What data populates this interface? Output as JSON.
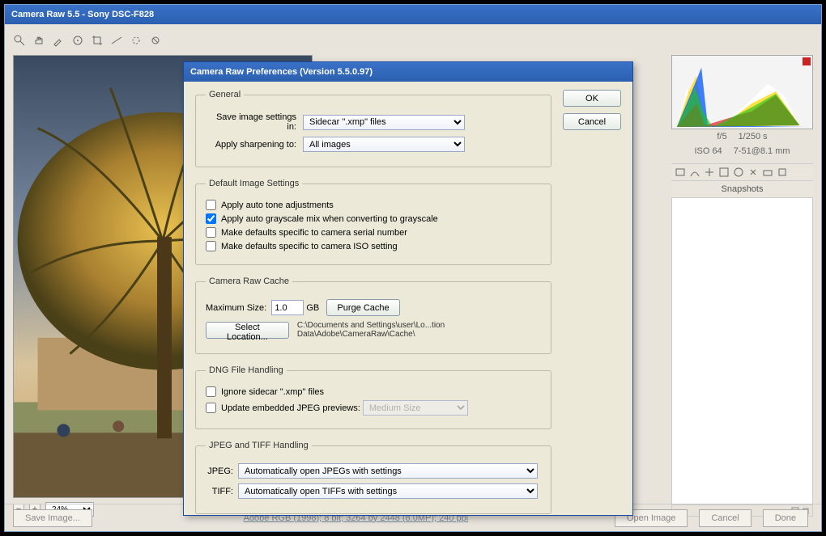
{
  "app": {
    "title": "Camera Raw 5.5  -  Sony DSC-F828"
  },
  "zoom": {
    "value": "24%"
  },
  "footer": {
    "save_image": "Save Image...",
    "meta": "Adobe RGB (1998); 8 bit; 3264 by 2448 (8.0MP); 240 ppi",
    "open_image": "Open Image",
    "cancel": "Cancel",
    "done": "Done"
  },
  "right": {
    "info1a": "f/5",
    "info1b": "1/250 s",
    "info2a": "ISO 64",
    "info2b": "7-51@8.1 mm",
    "panel_title": "Snapshots"
  },
  "dialog": {
    "title": "Camera Raw Preferences  (Version 5.5.0.97)",
    "ok": "OK",
    "cancel": "Cancel",
    "general": {
      "legend": "General",
      "save_in_label": "Save image settings in:",
      "save_in_value": "Sidecar \".xmp\" files",
      "sharpen_label": "Apply sharpening to:",
      "sharpen_value": "All images"
    },
    "defaults": {
      "legend": "Default Image Settings",
      "auto_tone": "Apply auto tone adjustments",
      "auto_gray": "Apply auto grayscale mix when converting to grayscale",
      "serial": "Make defaults specific to camera serial number",
      "iso": "Make defaults specific to camera ISO setting"
    },
    "cache": {
      "legend": "Camera Raw Cache",
      "max_label": "Maximum Size:",
      "max_value": "1.0",
      "gb": "GB",
      "purge": "Purge Cache",
      "select": "Select Location...",
      "path": "C:\\Documents and Settings\\user\\Lo...tion Data\\Adobe\\CameraRaw\\Cache\\"
    },
    "dng": {
      "legend": "DNG File Handling",
      "ignore": "Ignore sidecar \".xmp\" files",
      "update": "Update embedded JPEG previews:",
      "update_value": "Medium Size"
    },
    "jt": {
      "legend": "JPEG and TIFF Handling",
      "jpeg_label": "JPEG:",
      "jpeg_value": "Automatically open JPEGs with settings",
      "tiff_label": "TIFF:",
      "tiff_value": "Automatically open TIFFs with settings"
    }
  }
}
